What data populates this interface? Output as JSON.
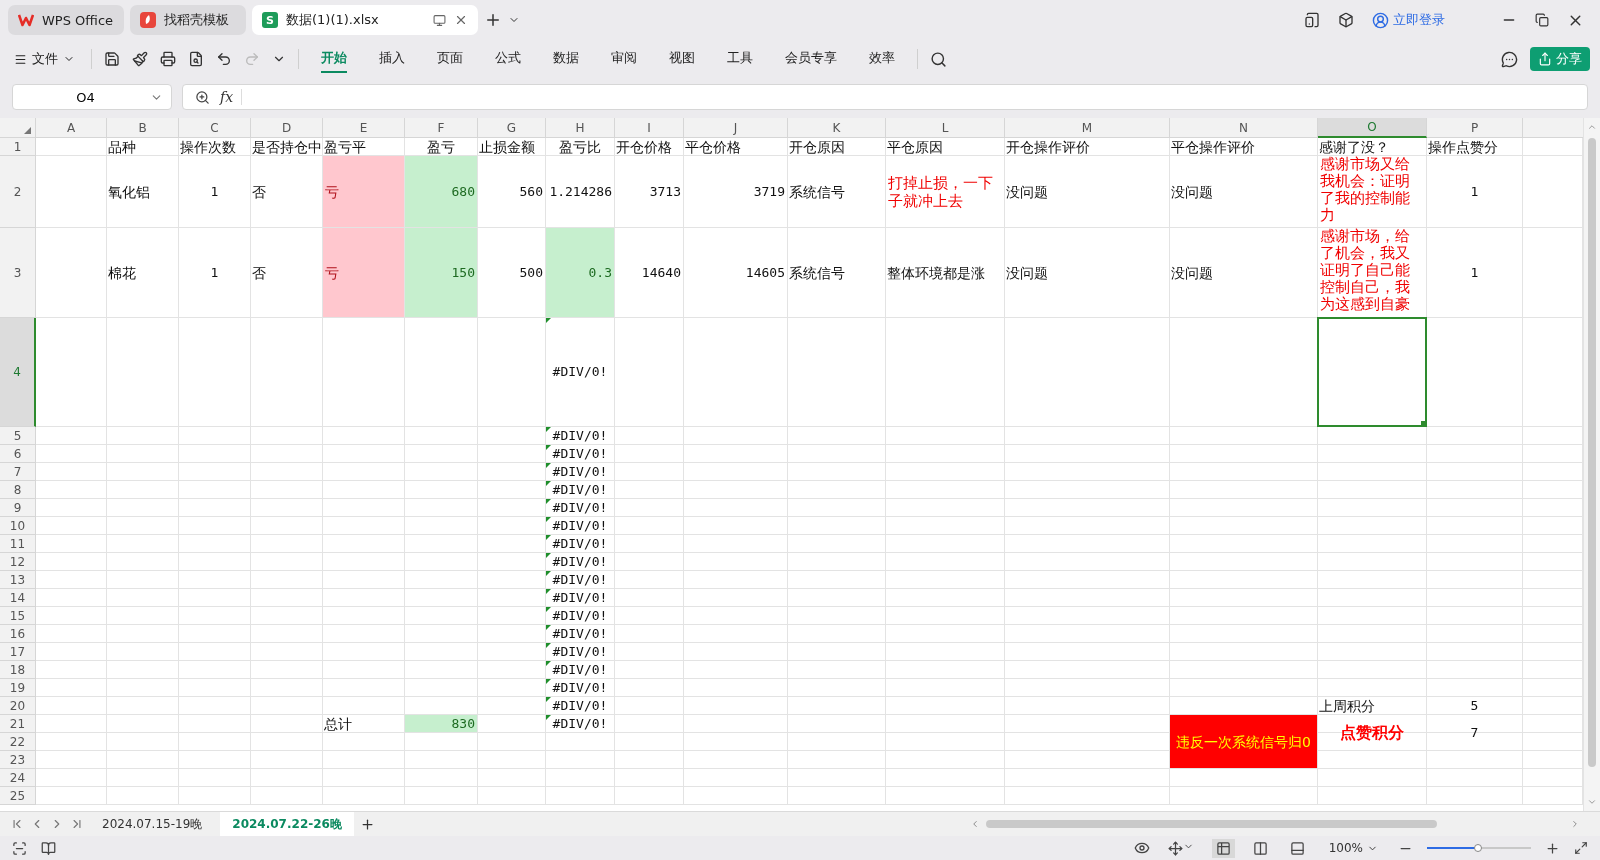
{
  "app_tabs": [
    {
      "kind": "wps",
      "label": "WPS Office",
      "selected": false
    },
    {
      "kind": "template",
      "label": "找稻壳模板",
      "selected": false
    },
    {
      "kind": "sheet",
      "badge": "S",
      "label": "数据(1)(1).xlsx",
      "selected": true
    }
  ],
  "account": {
    "label": "立即登录"
  },
  "file_menu": {
    "label": "文件"
  },
  "ribbon_tabs": [
    {
      "label": "开始",
      "selected": true
    },
    {
      "label": "插入",
      "selected": false
    },
    {
      "label": "页面",
      "selected": false
    },
    {
      "label": "公式",
      "selected": false
    },
    {
      "label": "数据",
      "selected": false
    },
    {
      "label": "审阅",
      "selected": false
    },
    {
      "label": "视图",
      "selected": false
    },
    {
      "label": "工具",
      "selected": false
    },
    {
      "label": "会员专享",
      "selected": false
    },
    {
      "label": "效率",
      "selected": false
    }
  ],
  "share_button": {
    "label": "分享"
  },
  "name_box": {
    "value": "O4"
  },
  "formula_bar": {
    "function_label": "fx"
  },
  "sheet": {
    "columns": [
      {
        "letter": "A",
        "selected": false
      },
      {
        "letter": "B",
        "selected": false
      },
      {
        "letter": "C",
        "selected": false
      },
      {
        "letter": "D",
        "selected": false
      },
      {
        "letter": "E",
        "selected": false
      },
      {
        "letter": "F",
        "selected": false
      },
      {
        "letter": "G",
        "selected": false
      },
      {
        "letter": "H",
        "selected": false
      },
      {
        "letter": "I",
        "selected": false
      },
      {
        "letter": "J",
        "selected": false
      },
      {
        "letter": "K",
        "selected": false
      },
      {
        "letter": "L",
        "selected": false
      },
      {
        "letter": "M",
        "selected": false
      },
      {
        "letter": "N",
        "selected": false
      },
      {
        "letter": "O",
        "selected": true
      },
      {
        "letter": "P",
        "selected": false
      }
    ],
    "rows": [
      {
        "number": "1",
        "selected": false,
        "cells": [
          "",
          {
            "kind": "label",
            "text": "品种"
          },
          {
            "kind": "label",
            "text": "操作次数"
          },
          {
            "kind": "label",
            "text": "是否持仓中"
          },
          {
            "kind": "label",
            "text": "盈亏平"
          },
          {
            "kind": "title",
            "text": "盈亏"
          },
          {
            "kind": "label",
            "text": "止损金额"
          },
          {
            "kind": "title",
            "text": "盈亏比"
          },
          {
            "kind": "label",
            "text": "开仓价格"
          },
          {
            "kind": "label",
            "text": "平仓价格"
          },
          {
            "kind": "label",
            "text": "开仓原因"
          },
          {
            "kind": "label",
            "text": "平仓原因"
          },
          {
            "kind": "label",
            "text": "开仓操作评价"
          },
          {
            "kind": "label",
            "text": "平仓操作评价"
          },
          {
            "kind": "label",
            "text": "感谢了没？"
          },
          {
            "kind": "label",
            "text": "操作点赞分"
          }
        ]
      },
      {
        "number": "2",
        "selected": false,
        "cells": [
          "",
          {
            "kind": "label",
            "text": "氧化铝"
          },
          {
            "kind": "count",
            "text": "1"
          },
          {
            "kind": "label",
            "text": "否"
          },
          {
            "kind": "loss",
            "text": "亏"
          },
          {
            "kind": "gain",
            "text": "680"
          },
          {
            "kind": "number",
            "text": "560"
          },
          {
            "kind": "number",
            "text": "1.214286"
          },
          {
            "kind": "number",
            "text": "3713"
          },
          {
            "kind": "number",
            "text": "3719"
          },
          {
            "kind": "label",
            "text": "系统信号"
          },
          {
            "kind": "remark",
            "text": "打掉止损，一下子就冲上去"
          },
          {
            "kind": "label",
            "text": "没问题"
          },
          {
            "kind": "label",
            "text": "没问题"
          },
          {
            "kind": "note",
            "text": "感谢市场又给我机会：证明了我的控制能力"
          },
          {
            "kind": "count",
            "text": "1"
          }
        ]
      },
      {
        "number": "3",
        "selected": false,
        "cells": [
          "",
          {
            "kind": "label",
            "text": "棉花"
          },
          {
            "kind": "count",
            "text": "1"
          },
          {
            "kind": "label",
            "text": "否"
          },
          {
            "kind": "loss",
            "text": "亏"
          },
          {
            "kind": "gain",
            "text": "150"
          },
          {
            "kind": "number",
            "text": "500"
          },
          {
            "kind": "gain",
            "text": "0.3"
          },
          {
            "kind": "number",
            "text": "14640"
          },
          {
            "kind": "number",
            "text": "14605"
          },
          {
            "kind": "label",
            "text": "系统信号"
          },
          {
            "kind": "label",
            "text": "整体环境都是涨"
          },
          {
            "kind": "label",
            "text": "没问题"
          },
          {
            "kind": "label",
            "text": "没问题"
          },
          {
            "kind": "note",
            "text": "感谢市场，给了机会，我又证明了自己能控制自己，我为这感到自豪"
          },
          {
            "kind": "count",
            "text": "1"
          }
        ]
      },
      {
        "number": "4",
        "selected": true,
        "cells": [
          "",
          "",
          "",
          "",
          "",
          "",
          "",
          {
            "kind": "error",
            "text": "#DIV/0!"
          }
        ]
      },
      {
        "number": "5",
        "selected": false,
        "cells": [
          "",
          "",
          "",
          "",
          "",
          "",
          "",
          {
            "kind": "error",
            "text": "#DIV/0!"
          }
        ]
      },
      {
        "number": "6",
        "selected": false,
        "cells": [
          "",
          "",
          "",
          "",
          "",
          "",
          "",
          {
            "kind": "error",
            "text": "#DIV/0!"
          }
        ]
      },
      {
        "number": "7",
        "selected": false,
        "cells": [
          "",
          "",
          "",
          "",
          "",
          "",
          "",
          {
            "kind": "error",
            "text": "#DIV/0!"
          }
        ]
      },
      {
        "number": "8",
        "selected": false,
        "cells": [
          "",
          "",
          "",
          "",
          "",
          "",
          "",
          {
            "kind": "error",
            "text": "#DIV/0!"
          }
        ]
      },
      {
        "number": "9",
        "selected": false,
        "cells": [
          "",
          "",
          "",
          "",
          "",
          "",
          "",
          {
            "kind": "error",
            "text": "#DIV/0!"
          }
        ]
      },
      {
        "number": "10",
        "selected": false,
        "cells": [
          "",
          "",
          "",
          "",
          "",
          "",
          "",
          {
            "kind": "error",
            "text": "#DIV/0!"
          }
        ]
      },
      {
        "number": "11",
        "selected": false,
        "cells": [
          "",
          "",
          "",
          "",
          "",
          "",
          "",
          {
            "kind": "error",
            "text": "#DIV/0!"
          }
        ]
      },
      {
        "number": "12",
        "selected": false,
        "cells": [
          "",
          "",
          "",
          "",
          "",
          "",
          "",
          {
            "kind": "error",
            "text": "#DIV/0!"
          }
        ]
      },
      {
        "number": "13",
        "selected": false,
        "cells": [
          "",
          "",
          "",
          "",
          "",
          "",
          "",
          {
            "kind": "error",
            "text": "#DIV/0!"
          }
        ]
      },
      {
        "number": "14",
        "selected": false,
        "cells": [
          "",
          "",
          "",
          "",
          "",
          "",
          "",
          {
            "kind": "error",
            "text": "#DIV/0!"
          }
        ]
      },
      {
        "number": "15",
        "selected": false,
        "cells": [
          "",
          "",
          "",
          "",
          "",
          "",
          "",
          {
            "kind": "error",
            "text": "#DIV/0!"
          }
        ]
      },
      {
        "number": "16",
        "selected": false,
        "cells": [
          "",
          "",
          "",
          "",
          "",
          "",
          "",
          {
            "kind": "error",
            "text": "#DIV/0!"
          }
        ]
      },
      {
        "number": "17",
        "selected": false,
        "cells": [
          "",
          "",
          "",
          "",
          "",
          "",
          "",
          {
            "kind": "error",
            "text": "#DIV/0!"
          }
        ]
      },
      {
        "number": "18",
        "selected": false,
        "cells": [
          "",
          "",
          "",
          "",
          "",
          "",
          "",
          {
            "kind": "error",
            "text": "#DIV/0!"
          }
        ]
      },
      {
        "number": "19",
        "selected": false,
        "cells": [
          "",
          "",
          "",
          "",
          "",
          "",
          "",
          {
            "kind": "error",
            "text": "#DIV/0!"
          }
        ]
      },
      {
        "number": "20",
        "selected": false,
        "cells": [
          "",
          "",
          "",
          "",
          "",
          "",
          "",
          {
            "kind": "error",
            "text": "#DIV/0!"
          },
          "",
          "",
          "",
          "",
          "",
          "",
          {
            "kind": "label",
            "text": "上周积分"
          },
          {
            "kind": "count",
            "text": "5"
          }
        ]
      },
      {
        "number": "21",
        "selected": false,
        "cells": [
          "",
          "",
          "",
          "",
          {
            "kind": "label",
            "text": "总计"
          },
          {
            "kind": "gain",
            "text": "830"
          },
          "",
          {
            "kind": "error",
            "text": "#DIV/0!"
          },
          "",
          "",
          "",
          "",
          "",
          {
            "kind": "alert",
            "text": "违反一次系统信号归0"
          },
          {
            "kind": "highlight",
            "text": "点赞积分"
          },
          {
            "kind": "count",
            "text": "7"
          }
        ]
      },
      {
        "number": "22",
        "selected": false,
        "cells": [
          "",
          "",
          "",
          "",
          "",
          "",
          "",
          "",
          "",
          "",
          "",
          "",
          "",
          {
            "merged": true
          },
          {
            "merged": true
          },
          {
            "merged": true
          }
        ]
      },
      {
        "number": "23",
        "selected": false,
        "cells": [
          "",
          "",
          "",
          "",
          "",
          "",
          "",
          "",
          "",
          "",
          "",
          "",
          "",
          {
            "merged": true
          }
        ]
      },
      {
        "number": "24",
        "selected": false
      },
      {
        "number": "25",
        "selected": false
      }
    ]
  },
  "sheet_tabs": [
    {
      "label": "2024.07.15-19晚",
      "selected": false
    },
    {
      "label": "2024.07.22-26晚",
      "selected": true
    }
  ],
  "status_bar": {
    "zoom": "100%",
    "zoom_slider": {
      "level": 0.49
    }
  }
}
